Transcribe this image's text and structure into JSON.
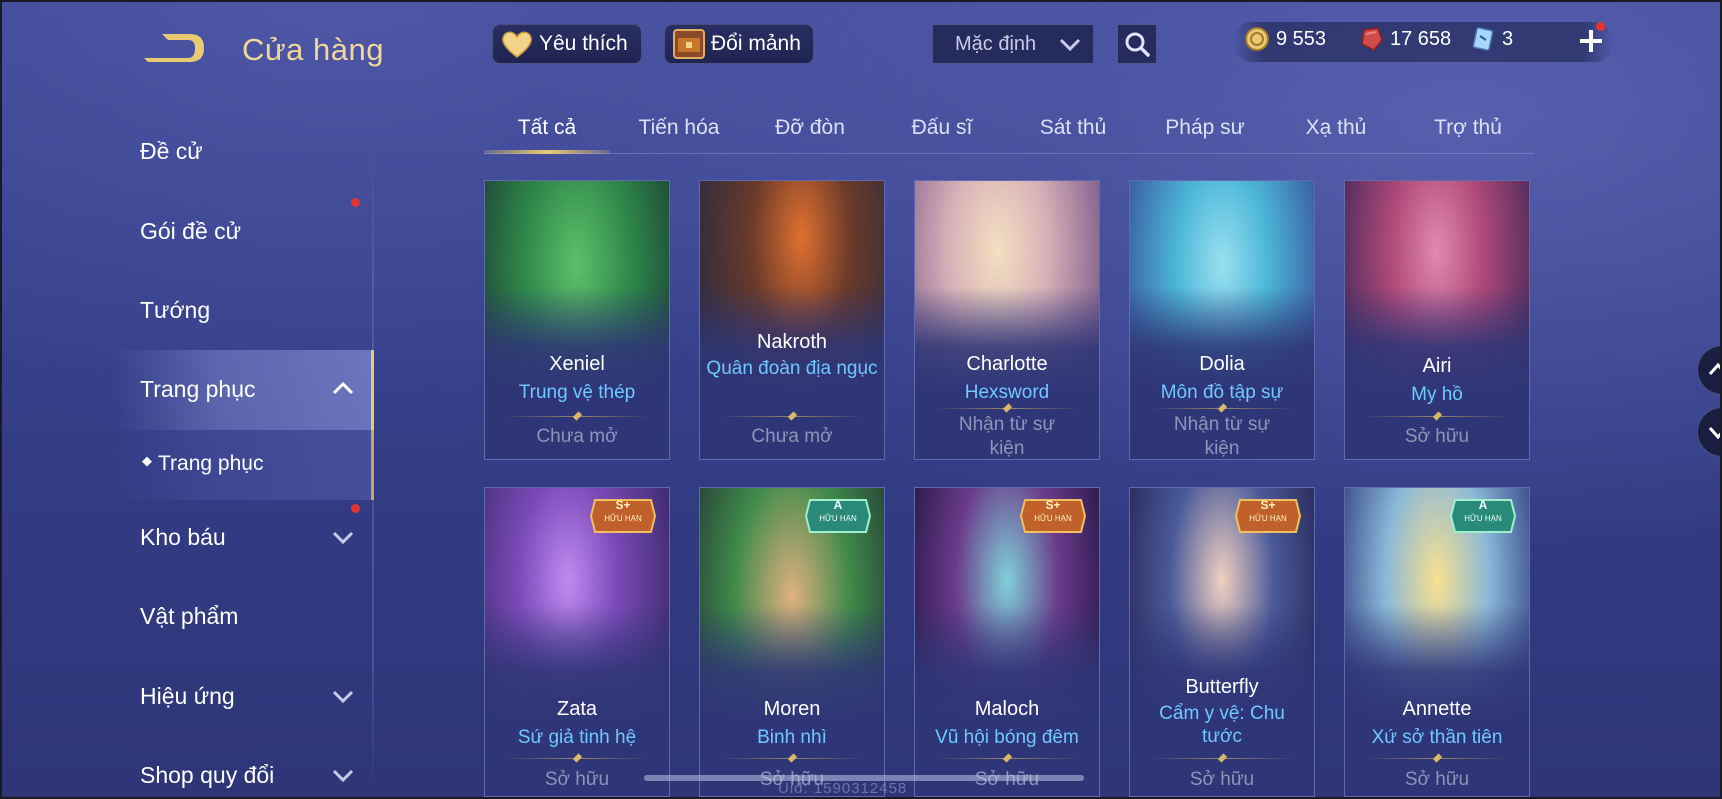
{
  "header": {
    "title": "Cửa hàng",
    "favorite_label": "Yêu thích",
    "exchange_label": "Đổi mảnh",
    "sort_value": "Mặc định"
  },
  "currency": {
    "gold": "9 553",
    "gems": "17 658",
    "vouchers": "3"
  },
  "sidebar": {
    "items": [
      {
        "label": "Đề cử"
      },
      {
        "label": "Gói đề cử"
      },
      {
        "label": "Tướng"
      },
      {
        "label": "Trang phục"
      },
      {
        "label": "Trang phục"
      },
      {
        "label": "Kho báu"
      },
      {
        "label": "Vật phẩm"
      },
      {
        "label": "Hiệu ứng"
      },
      {
        "label": "Shop quy đổi"
      }
    ]
  },
  "tabs": [
    {
      "label": "Tất cả"
    },
    {
      "label": "Tiến hóa"
    },
    {
      "label": "Đỡ đòn"
    },
    {
      "label": "Đấu sĩ"
    },
    {
      "label": "Sát thủ"
    },
    {
      "label": "Pháp sư"
    },
    {
      "label": "Xạ thủ"
    },
    {
      "label": "Trợ thủ"
    }
  ],
  "cards_row1": [
    {
      "hero": "Xeniel",
      "skin": "Trung vệ thép",
      "status": "Chưa mở",
      "color": "#2f8a4a"
    },
    {
      "hero": "Nakroth",
      "skin": "Quân đoàn địa ngục",
      "status": "Chưa mở",
      "color": "#5a3a2a"
    },
    {
      "hero": "Charlotte",
      "skin": "Hexsword",
      "status": "Nhận từ sự kiện",
      "color": "#c9a7b0"
    },
    {
      "hero": "Dolia",
      "skin": "Môn đồ tập sự",
      "status": "Nhận từ sự kiện",
      "color": "#4cb7d8"
    },
    {
      "hero": "Airi",
      "skin": "My hồ",
      "status": "Sở hữu",
      "color": "#b04a7a"
    }
  ],
  "cards_row2": [
    {
      "hero": "Zata",
      "skin": "Sứ giả tinh hệ",
      "status": "Sở hữu",
      "badge_rank": "S+",
      "badge_text": "HỮU HẠN",
      "color": "#7a4ab8"
    },
    {
      "hero": "Moren",
      "skin": "Binh nhì",
      "status": "Sở hữu",
      "badge_rank": "A",
      "badge_text": "HỮU HẠN",
      "color": "#3f8a4a"
    },
    {
      "hero": "Maloch",
      "skin": "Vũ hội bóng đêm",
      "status": "Sở hữu",
      "badge_rank": "S+",
      "badge_text": "HỮU HẠN",
      "color": "#6a3a8a"
    },
    {
      "hero": "Butterfly",
      "skin": "Cẩm y vệ: Chu tước",
      "status": "Sở hữu",
      "badge_rank": "S+",
      "badge_text": "HỮU HẠN",
      "color": "#4a5a9a"
    },
    {
      "hero": "Annette",
      "skin": "Xứ sở thần tiên",
      "status": "Sở hữu",
      "badge_rank": "A",
      "badge_text": "HỮU HẠN",
      "color": "#8ab8d8"
    }
  ],
  "footer": {
    "uid": "Uid: 1590312458"
  },
  "colors": {
    "gold_accent": "#e9c971",
    "skin_name": "#6fc8ff",
    "status_gray": "#8f94b8",
    "notification": "#e43535"
  }
}
